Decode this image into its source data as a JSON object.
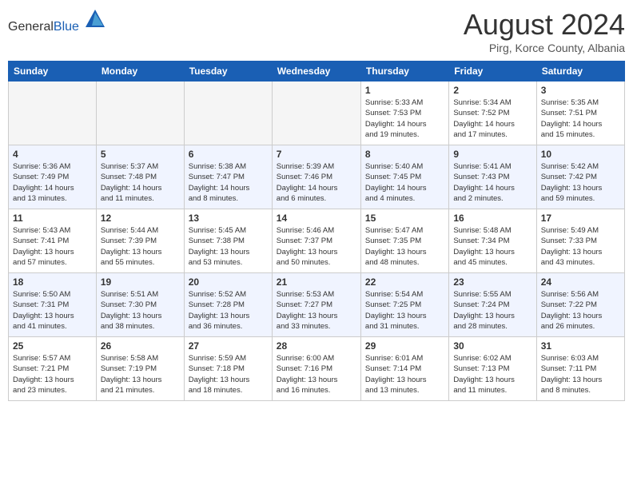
{
  "header": {
    "logo_general": "General",
    "logo_blue": "Blue",
    "month_title": "August 2024",
    "location": "Pirg, Korce County, Albania"
  },
  "weekdays": [
    "Sunday",
    "Monday",
    "Tuesday",
    "Wednesday",
    "Thursday",
    "Friday",
    "Saturday"
  ],
  "weeks": [
    {
      "days": [
        {
          "num": "",
          "info": ""
        },
        {
          "num": "",
          "info": ""
        },
        {
          "num": "",
          "info": ""
        },
        {
          "num": "",
          "info": ""
        },
        {
          "num": "1",
          "info": "Sunrise: 5:33 AM\nSunset: 7:53 PM\nDaylight: 14 hours\nand 19 minutes."
        },
        {
          "num": "2",
          "info": "Sunrise: 5:34 AM\nSunset: 7:52 PM\nDaylight: 14 hours\nand 17 minutes."
        },
        {
          "num": "3",
          "info": "Sunrise: 5:35 AM\nSunset: 7:51 PM\nDaylight: 14 hours\nand 15 minutes."
        }
      ]
    },
    {
      "days": [
        {
          "num": "4",
          "info": "Sunrise: 5:36 AM\nSunset: 7:49 PM\nDaylight: 14 hours\nand 13 minutes."
        },
        {
          "num": "5",
          "info": "Sunrise: 5:37 AM\nSunset: 7:48 PM\nDaylight: 14 hours\nand 11 minutes."
        },
        {
          "num": "6",
          "info": "Sunrise: 5:38 AM\nSunset: 7:47 PM\nDaylight: 14 hours\nand 8 minutes."
        },
        {
          "num": "7",
          "info": "Sunrise: 5:39 AM\nSunset: 7:46 PM\nDaylight: 14 hours\nand 6 minutes."
        },
        {
          "num": "8",
          "info": "Sunrise: 5:40 AM\nSunset: 7:45 PM\nDaylight: 14 hours\nand 4 minutes."
        },
        {
          "num": "9",
          "info": "Sunrise: 5:41 AM\nSunset: 7:43 PM\nDaylight: 14 hours\nand 2 minutes."
        },
        {
          "num": "10",
          "info": "Sunrise: 5:42 AM\nSunset: 7:42 PM\nDaylight: 13 hours\nand 59 minutes."
        }
      ]
    },
    {
      "days": [
        {
          "num": "11",
          "info": "Sunrise: 5:43 AM\nSunset: 7:41 PM\nDaylight: 13 hours\nand 57 minutes."
        },
        {
          "num": "12",
          "info": "Sunrise: 5:44 AM\nSunset: 7:39 PM\nDaylight: 13 hours\nand 55 minutes."
        },
        {
          "num": "13",
          "info": "Sunrise: 5:45 AM\nSunset: 7:38 PM\nDaylight: 13 hours\nand 53 minutes."
        },
        {
          "num": "14",
          "info": "Sunrise: 5:46 AM\nSunset: 7:37 PM\nDaylight: 13 hours\nand 50 minutes."
        },
        {
          "num": "15",
          "info": "Sunrise: 5:47 AM\nSunset: 7:35 PM\nDaylight: 13 hours\nand 48 minutes."
        },
        {
          "num": "16",
          "info": "Sunrise: 5:48 AM\nSunset: 7:34 PM\nDaylight: 13 hours\nand 45 minutes."
        },
        {
          "num": "17",
          "info": "Sunrise: 5:49 AM\nSunset: 7:33 PM\nDaylight: 13 hours\nand 43 minutes."
        }
      ]
    },
    {
      "days": [
        {
          "num": "18",
          "info": "Sunrise: 5:50 AM\nSunset: 7:31 PM\nDaylight: 13 hours\nand 41 minutes."
        },
        {
          "num": "19",
          "info": "Sunrise: 5:51 AM\nSunset: 7:30 PM\nDaylight: 13 hours\nand 38 minutes."
        },
        {
          "num": "20",
          "info": "Sunrise: 5:52 AM\nSunset: 7:28 PM\nDaylight: 13 hours\nand 36 minutes."
        },
        {
          "num": "21",
          "info": "Sunrise: 5:53 AM\nSunset: 7:27 PM\nDaylight: 13 hours\nand 33 minutes."
        },
        {
          "num": "22",
          "info": "Sunrise: 5:54 AM\nSunset: 7:25 PM\nDaylight: 13 hours\nand 31 minutes."
        },
        {
          "num": "23",
          "info": "Sunrise: 5:55 AM\nSunset: 7:24 PM\nDaylight: 13 hours\nand 28 minutes."
        },
        {
          "num": "24",
          "info": "Sunrise: 5:56 AM\nSunset: 7:22 PM\nDaylight: 13 hours\nand 26 minutes."
        }
      ]
    },
    {
      "days": [
        {
          "num": "25",
          "info": "Sunrise: 5:57 AM\nSunset: 7:21 PM\nDaylight: 13 hours\nand 23 minutes."
        },
        {
          "num": "26",
          "info": "Sunrise: 5:58 AM\nSunset: 7:19 PM\nDaylight: 13 hours\nand 21 minutes."
        },
        {
          "num": "27",
          "info": "Sunrise: 5:59 AM\nSunset: 7:18 PM\nDaylight: 13 hours\nand 18 minutes."
        },
        {
          "num": "28",
          "info": "Sunrise: 6:00 AM\nSunset: 7:16 PM\nDaylight: 13 hours\nand 16 minutes."
        },
        {
          "num": "29",
          "info": "Sunrise: 6:01 AM\nSunset: 7:14 PM\nDaylight: 13 hours\nand 13 minutes."
        },
        {
          "num": "30",
          "info": "Sunrise: 6:02 AM\nSunset: 7:13 PM\nDaylight: 13 hours\nand 11 minutes."
        },
        {
          "num": "31",
          "info": "Sunrise: 6:03 AM\nSunset: 7:11 PM\nDaylight: 13 hours\nand 8 minutes."
        }
      ]
    }
  ]
}
